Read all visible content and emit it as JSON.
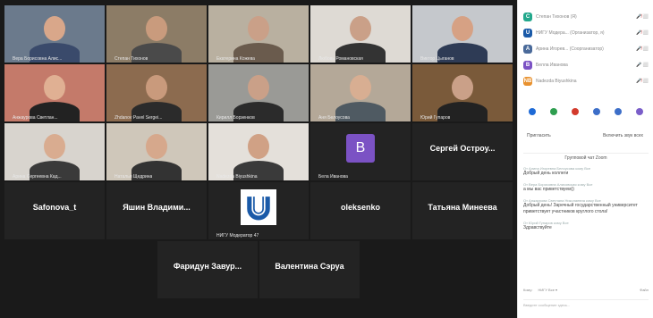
{
  "tiles": [
    {
      "name": "Вера Борисовна Алис...",
      "type": "video",
      "bg": "#6b7a8c",
      "skin": "#d9a78a",
      "cloth": "#3a4a6b"
    },
    {
      "name": "Степан Тихонов",
      "type": "video",
      "bg": "#8c7c66",
      "skin": "#c99b7d",
      "cloth": "#4a4a4a"
    },
    {
      "name": "Екатерина Кожева",
      "type": "video",
      "bg": "#b9b0a0",
      "skin": "#caa088",
      "cloth": "#6a5b4d"
    },
    {
      "name": "Любовь Романовская",
      "type": "video",
      "bg": "#dedad4",
      "skin": "#caa088",
      "cloth": "#333"
    },
    {
      "name": "Виктор Цыганов",
      "type": "video",
      "bg": "#c5c8cc",
      "skin": "#d6a184",
      "cloth": "#2e3b55"
    },
    {
      "name": "Анжаурова Светлан...",
      "type": "video",
      "bg": "#c47a6a",
      "skin": "#e0b093",
      "cloth": "#222"
    },
    {
      "name": "Zhdanov Pavel Sergei...",
      "type": "video",
      "bg": "#8c6b4f",
      "skin": "#c99a7c",
      "cloth": "#2b2b2b"
    },
    {
      "name": "Кирилл Борзенков",
      "type": "video",
      "bg": "#9a9a96",
      "skin": "#caa088",
      "cloth": "#2b2b2b"
    },
    {
      "name": "Аня Белоусова",
      "type": "video",
      "bg": "#b4a898",
      "skin": "#d8ae92",
      "cloth": "#4f5a62"
    },
    {
      "name": "Юрий Гупаров",
      "type": "video",
      "bg": "#7a5a3a",
      "skin": "#caa088",
      "cloth": "#222"
    },
    {
      "name": "Арина Сергеевна Кад...",
      "type": "video",
      "bg": "#d8d4ce",
      "skin": "#d9ac90",
      "cloth": "#3a3a3a"
    },
    {
      "name": "Наталья Щедрина",
      "type": "video",
      "bg": "#cfc7ba",
      "skin": "#d6a88c",
      "cloth": "#333"
    },
    {
      "name": "Nadezda Biyushkina",
      "type": "video",
      "bg": "#e4e0da",
      "skin": "#d0a185",
      "cloth": "#3a3a3a"
    },
    {
      "name": "Бела Иванова",
      "type": "avatar",
      "letter": "B",
      "color": "#7b52c4"
    },
    {
      "name": "",
      "type": "text",
      "label": "Сергей Остроу..."
    },
    {
      "name": "",
      "type": "text",
      "label": "Safonova_t"
    },
    {
      "name": "",
      "type": "text",
      "label": "Яшин Владими..."
    },
    {
      "name": "НИГУ Модератор 47",
      "type": "logo"
    },
    {
      "name": "",
      "type": "text",
      "label": "oleksenko"
    },
    {
      "name": "",
      "type": "text",
      "label": "Татьяна Минеева"
    },
    {
      "name": "",
      "type": "text",
      "label": "Фаридун Завур..."
    },
    {
      "name": "",
      "type": "text",
      "label": "Валентина Сэруа"
    }
  ],
  "participants": [
    {
      "initial": "C",
      "color": "#23a88c",
      "name": "Степан Тихонов (Я)",
      "status": "🎤̸ ⬜"
    },
    {
      "initial": "U",
      "color": "#1a5aa8",
      "name": "НИГУ Модера... (Организатор, я)",
      "status": "🎤̸ ⬜"
    },
    {
      "initial": "A",
      "color": "#4a6a9a",
      "name": "Арина Игорев... (Соорганизатор)",
      "status": "🎤̸ ⬜"
    },
    {
      "initial": "B",
      "color": "#7b52c4",
      "name": "Белла Иванова",
      "status": "🎤 ⬜"
    },
    {
      "initial": "NB",
      "color": "#e8912e",
      "name": "Nadezda Biyushkina",
      "status": "🎤̸ ⬜"
    }
  ],
  "reactions": [
    "#1e6ad6",
    "#2e9e4f",
    "#d33a2c",
    "#3c6ec8",
    "#3c6ec8",
    "#7a5ec9"
  ],
  "panel_buttons": {
    "invite": "Пригласить",
    "mute_all": "Включить звук всех"
  },
  "chat": {
    "header": "Групповой чат Zoom",
    "messages": [
      {
        "from": "От Алина Игоревна Белоусова кому Все",
        "text": "Добрый день коллеги"
      },
      {
        "from": "От Вера Борисовна Алисовская кому Все",
        "text": "а мы вас приветствуем))"
      },
      {
        "from": "От Анжаурова Светлана Николаевна кому Все",
        "text": "Добрый день! Заречный государственный университет приветствует участников круглого стола!"
      },
      {
        "from": "От Юрий Гупаров кому Все",
        "text": "Здравствуйте"
      }
    ],
    "to_label": "Кому:",
    "to_value": "НИГУ Все ▾",
    "file_label": "Файл",
    "input_placeholder": "Введите сообщение здесь..."
  }
}
